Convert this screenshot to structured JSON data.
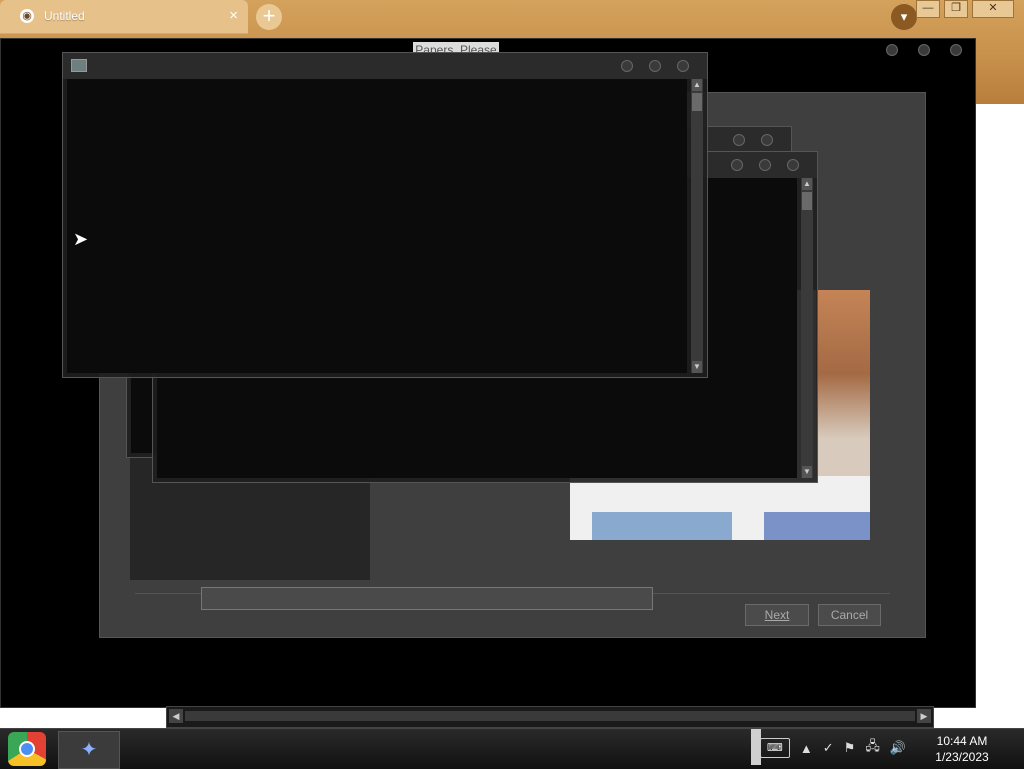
{
  "browser": {
    "tab_title": "Untitled",
    "new_tab_label": "+",
    "tab_close_label": "×",
    "window_buttons": [
      "—",
      "❐",
      "✕"
    ]
  },
  "game": {
    "title": "Papers, Please"
  },
  "dialog": {
    "next_label": "Next",
    "cancel_label": "Cancel"
  },
  "taskbar": {
    "time": "10:44 AM",
    "date": "1/23/2023",
    "tray_symbols": [
      "▲",
      "✓",
      "⚑",
      "🖧",
      "🔊"
    ]
  }
}
